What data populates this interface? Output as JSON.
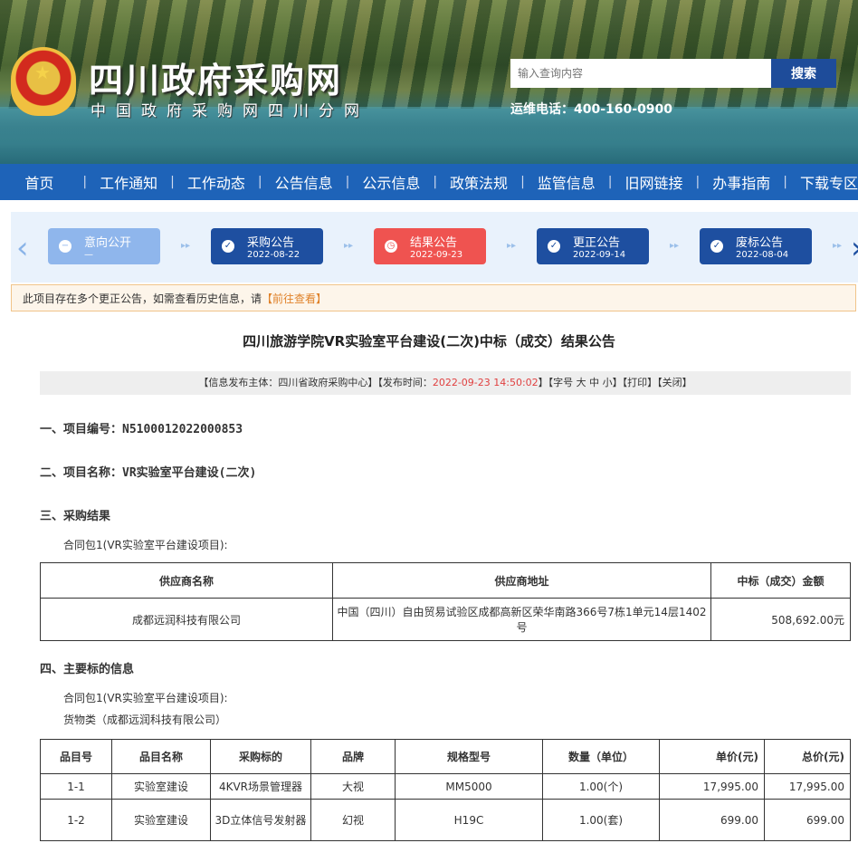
{
  "header": {
    "site_title": "四川政府采购网",
    "site_subtitle": "中国政府采购网四川分网",
    "search_placeholder": "输入查询内容",
    "search_button": "搜索",
    "hotline": "运维电话：400-160-0900"
  },
  "nav": [
    "首页",
    "工作通知",
    "工作动态",
    "公告信息",
    "公示信息",
    "政策法规",
    "监管信息",
    "旧网链接",
    "办事指南",
    "下载专区"
  ],
  "timeline": [
    {
      "label": "意向公开",
      "date": "—",
      "color": "#8fb6ec",
      "icon": "minus-icon"
    },
    {
      "label": "采购公告",
      "date": "2022-08-22",
      "color": "#1e4fa0",
      "icon": "check-icon"
    },
    {
      "label": "结果公告",
      "date": "2022-09-23",
      "color": "#ef5350",
      "icon": "clock-icon"
    },
    {
      "label": "更正公告",
      "date": "2022-09-14",
      "color": "#1e4fa0",
      "icon": "check-icon"
    },
    {
      "label": "废标公告",
      "date": "2022-08-04",
      "color": "#1e4fa0",
      "icon": "check-icon"
    }
  ],
  "notice": {
    "text": "此项目存在多个更正公告，如需查看历史信息，请",
    "link": "【前往查看】"
  },
  "title": "四川旅游学院VR实验室平台建设(二次)中标（成交）结果公告",
  "meta": {
    "prefix": "【信息发布主体：四川省政府采购中心】【发布时间：",
    "time": "2022-09-23 14:50:02",
    "suffix": "】【字号 大 中 小】【打印】【关闭】"
  },
  "sections": {
    "s1": "一、项目编号：N5100012022000853",
    "s2": "二、项目名称：VR实验室平台建设(二次)",
    "s3": "三、采购结果",
    "s3_pkg": "合同包1(VR实验室平台建设项目):",
    "s4": "四、主要标的信息",
    "s4_pkg": "合同包1(VR实验室平台建设项目):",
    "s4_cat": "货物类（成都远润科技有限公司）"
  },
  "result_table": {
    "headers": [
      "供应商名称",
      "供应商地址",
      "中标（成交）金额"
    ],
    "rows": [
      [
        "成都远润科技有限公司",
        "中国（四川）自由贸易试验区成都高新区荣华南路366号7栋1单元14层1402号",
        "508,692.00元"
      ]
    ]
  },
  "items_table": {
    "headers": [
      "品目号",
      "品目名称",
      "采购标的",
      "品牌",
      "规格型号",
      "数量（单位）",
      "单价(元)",
      "总价(元)"
    ],
    "rows": [
      [
        "1-1",
        "实验室建设",
        "4KVR场景管理器",
        "大视",
        "MM5000",
        "1.00(个)",
        "17,995.00",
        "17,995.00"
      ],
      [
        "1-2",
        "实验室建设",
        "3D立体信号发射器",
        "幻视",
        "H19C",
        "1.00(套)",
        "699.00",
        "699.00"
      ]
    ]
  }
}
